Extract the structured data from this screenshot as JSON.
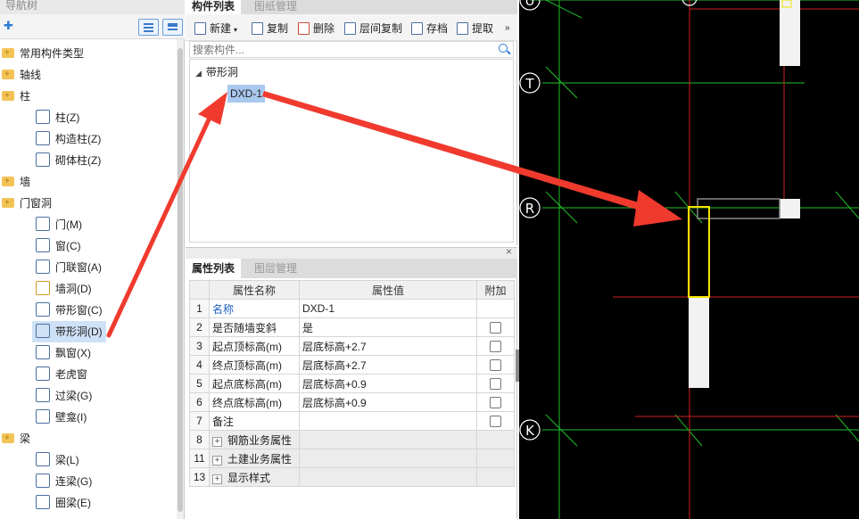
{
  "nav": {
    "title": "导航树",
    "add_icon": "add-icon",
    "groups": [
      {
        "label": "常用构件类型"
      },
      {
        "label": "轴线"
      },
      {
        "label": "柱"
      },
      {
        "label": "墙"
      },
      {
        "label": "门窗洞"
      },
      {
        "label": "梁"
      }
    ],
    "items": {
      "column": [
        {
          "label": "柱(Z)",
          "icon": "column-icon"
        },
        {
          "label": "构造柱(Z)",
          "icon": "structural-column-icon"
        },
        {
          "label": "砌体柱(Z)",
          "icon": "masonry-column-icon"
        }
      ],
      "openings": [
        {
          "label": "门(M)",
          "icon": "door-icon"
        },
        {
          "label": "窗(C)",
          "icon": "window-icon"
        },
        {
          "label": "门联窗(A)",
          "icon": "door-window-icon"
        },
        {
          "label": "墙洞(D)",
          "icon": "wall-hole-icon"
        },
        {
          "label": "带形窗(C)",
          "icon": "strip-window-icon"
        },
        {
          "label": "带形洞(D)",
          "icon": "strip-hole-icon"
        },
        {
          "label": "飘窗(X)",
          "icon": "bay-window-icon"
        },
        {
          "label": "老虎窗",
          "icon": "dormer-icon"
        },
        {
          "label": "过梁(G)",
          "icon": "lintel-icon"
        },
        {
          "label": "壁龛(I)",
          "icon": "niche-icon"
        }
      ],
      "beam": [
        {
          "label": "梁(L)",
          "icon": "beam-icon"
        },
        {
          "label": "连梁(G)",
          "icon": "coupling-beam-icon"
        },
        {
          "label": "圈梁(E)",
          "icon": "ring-beam-icon"
        }
      ]
    }
  },
  "component": {
    "tabs": [
      "构件列表",
      "图纸管理"
    ],
    "toolbar": {
      "new": "新建",
      "copy": "复制",
      "delete": "删除",
      "floor_copy": "层间复制",
      "save": "存档",
      "extract": "提取",
      "more": "»"
    },
    "search_placeholder": "搜索构件...",
    "tree_root": "带形洞",
    "tree_child": "DXD-1"
  },
  "properties": {
    "close": "×",
    "tabs": [
      "属性列表",
      "图层管理"
    ],
    "headers": {
      "num": "",
      "name": "属性名称",
      "value": "属性值",
      "extra": "附加"
    },
    "rows": [
      {
        "num": "1",
        "name": "名称",
        "value": "DXD-1"
      },
      {
        "num": "2",
        "name": "是否随墙变斜",
        "value": "是"
      },
      {
        "num": "3",
        "name": "起点顶标高(m)",
        "value": "层底标高+2.7"
      },
      {
        "num": "4",
        "name": "终点顶标高(m)",
        "value": "层底标高+2.7"
      },
      {
        "num": "5",
        "name": "起点底标高(m)",
        "value": "层底标高+0.9"
      },
      {
        "num": "6",
        "name": "终点底标高(m)",
        "value": "层底标高+0.9"
      },
      {
        "num": "7",
        "name": "备注",
        "value": ""
      },
      {
        "num": "8",
        "name": "钢筋业务属性",
        "value": ""
      },
      {
        "num": "11",
        "name": "土建业务属性",
        "value": ""
      },
      {
        "num": "13",
        "name": "显示样式",
        "value": ""
      }
    ]
  },
  "cad": {
    "axis_labels": [
      "U",
      "T",
      "R",
      "K"
    ],
    "colors": {
      "background": "#000000",
      "grid_green": "#1fbf2a",
      "grid_red": "#d02020",
      "highlight_yellow": "#f2e200",
      "annotation_arrow": "#f03a2e"
    }
  }
}
